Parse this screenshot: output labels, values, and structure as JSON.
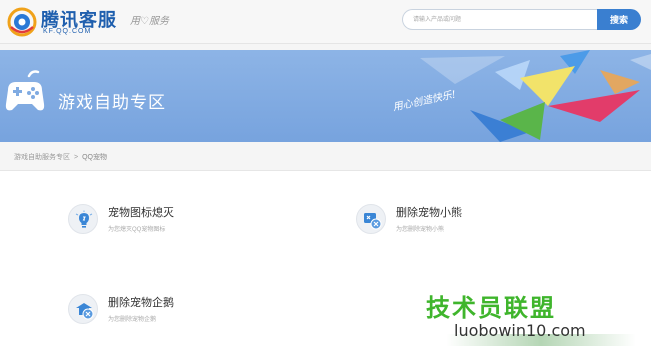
{
  "header": {
    "brand_name": "腾讯客服",
    "domain": "KF.QQ.COM",
    "slogan": "用♡服务"
  },
  "search": {
    "placeholder": "请输入产品或问题",
    "button_label": "搜索"
  },
  "banner": {
    "title": "游戏自助专区",
    "tagline": "用心创造快乐!"
  },
  "breadcrumb": {
    "parent": "游戏自助服务专区",
    "separator": ">",
    "current": "QQ宠物"
  },
  "services": [
    {
      "title": "宠物图标熄灭",
      "description": "为您熄灭QQ宠物图标",
      "icon": "lightbulb-icon"
    },
    {
      "title": "删除宠物小熊",
      "description": "为您删除宠物小熊",
      "icon": "delete-pet-bear-icon"
    },
    {
      "title": "删除宠物企鹅",
      "description": "为您删除宠物企鹅",
      "icon": "delete-pet-penguin-icon"
    }
  ],
  "watermark": {
    "line1": "技术员联盟",
    "line2": "luobowin10.com"
  },
  "colors": {
    "brand_blue": "#1f5fae",
    "banner_blue": "#80abe2",
    "search_button": "#3a7fd0",
    "watermark_green": "#3fb52c"
  }
}
